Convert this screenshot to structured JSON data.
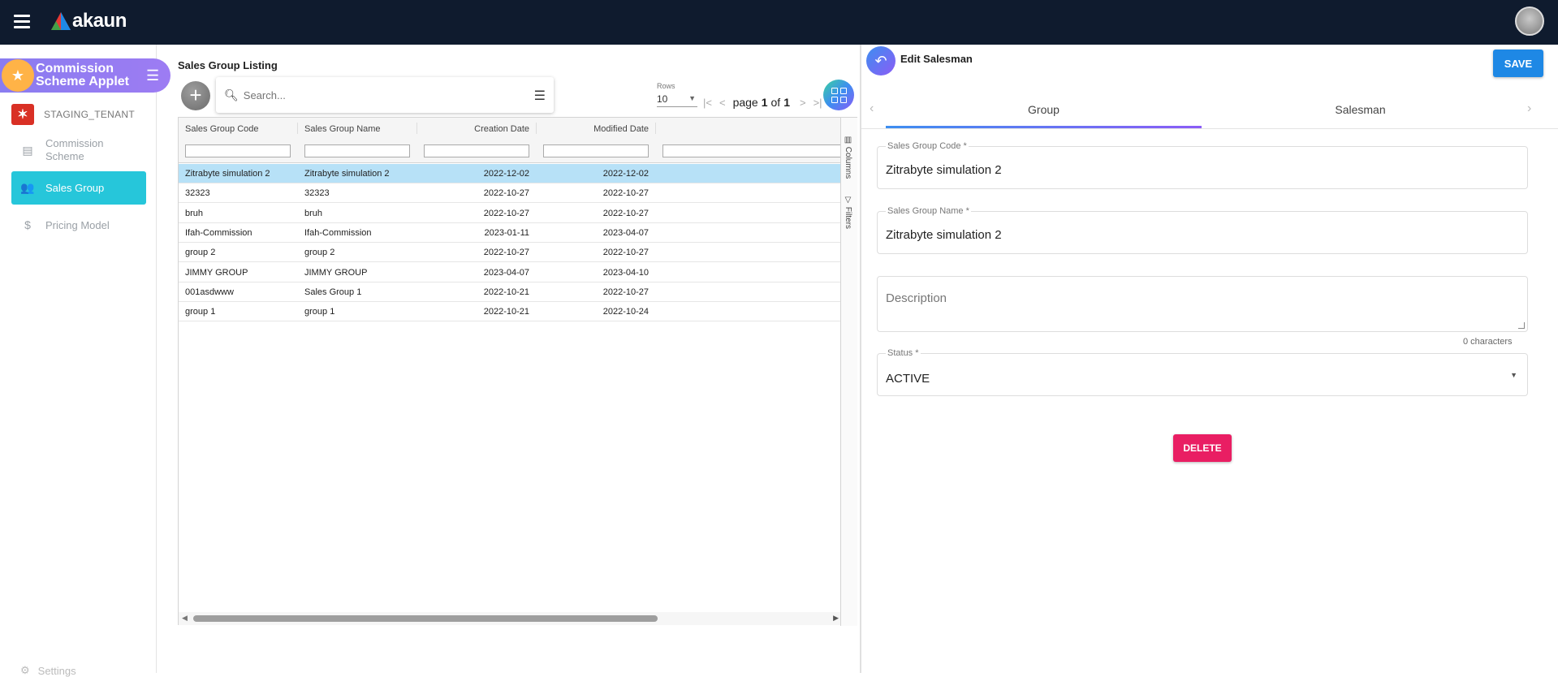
{
  "header": {
    "app_name": "akaun"
  },
  "sidebar": {
    "applet_title": "Commission Scheme Applet",
    "tenant": "STAGING_TENANT",
    "items": [
      {
        "label": "Commission Scheme",
        "icon": "list-icon",
        "active": false
      },
      {
        "label": "Sales Group",
        "icon": "group-icon",
        "active": true
      },
      {
        "label": "Pricing Model",
        "icon": "dollar-icon",
        "active": false
      }
    ],
    "settings_label": "Settings"
  },
  "listing": {
    "title": "Sales Group Listing",
    "search_placeholder": "Search...",
    "rows_label": "Rows",
    "rows_value": "10",
    "page_label": "page",
    "page_current": "1",
    "page_of": "of",
    "page_total": "1",
    "columns": [
      "Sales Group Code",
      "Sales Group Name",
      "Creation Date",
      "Modified Date"
    ],
    "side_tabs": [
      "Columns",
      "Filters"
    ],
    "rows": [
      {
        "code": "Zitrabyte simulation 2",
        "name": "Zitrabyte simulation 2",
        "created": "2022-12-02",
        "modified": "2022-12-02",
        "selected": true
      },
      {
        "code": "32323",
        "name": "32323",
        "created": "2022-10-27",
        "modified": "2022-10-27",
        "selected": false
      },
      {
        "code": "bruh",
        "name": "bruh",
        "created": "2022-10-27",
        "modified": "2022-10-27",
        "selected": false
      },
      {
        "code": "Ifah-Commission",
        "name": "Ifah-Commission",
        "created": "2023-01-11",
        "modified": "2023-04-07",
        "selected": false
      },
      {
        "code": "group 2",
        "name": "group 2",
        "created": "2022-10-27",
        "modified": "2022-10-27",
        "selected": false
      },
      {
        "code": "JIMMY GROUP",
        "name": "JIMMY GROUP",
        "created": "2023-04-07",
        "modified": "2023-04-10",
        "selected": false
      },
      {
        "code": "001asdwww",
        "name": "Sales Group 1",
        "created": "2022-10-21",
        "modified": "2022-10-27",
        "selected": false
      },
      {
        "code": "group 1",
        "name": "group 1",
        "created": "2022-10-21",
        "modified": "2022-10-24",
        "selected": false
      }
    ]
  },
  "edit": {
    "title": "Edit Salesman",
    "save_label": "SAVE",
    "tabs": [
      "Group",
      "Salesman"
    ],
    "fields": {
      "code_label": "Sales Group Code *",
      "code_value": "Zitrabyte simulation 2",
      "name_label": "Sales Group Name *",
      "name_value": "Zitrabyte simulation 2",
      "description_placeholder": "Description",
      "description_counter": "0 characters",
      "status_label": "Status *",
      "status_value": "ACTIVE"
    },
    "delete_label": "DELETE"
  },
  "colors": {
    "topbar": "#0f1b2e",
    "active_nav": "#26c6da",
    "save": "#1e88e5",
    "delete": "#e91e63",
    "selected_row": "#b7e1f7"
  }
}
